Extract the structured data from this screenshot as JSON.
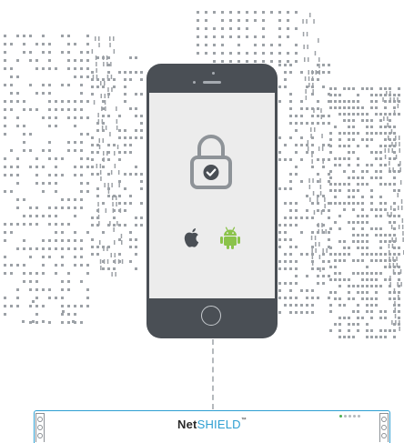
{
  "appliance": {
    "brand_prefix": "Net",
    "brand_main": "SHIELD",
    "brand_mark": "™",
    "leds": [
      true,
      false,
      false,
      false,
      false
    ]
  },
  "icons": {
    "lock": "lock-icon",
    "check": "check-circle-icon",
    "apple": "apple-logo-icon",
    "android": "android-logo-icon"
  },
  "colors": {
    "brand_blue": "#2e9fd2",
    "phone_body": "#4a4f55",
    "screen": "#ececec",
    "android_green": "#8bc34a",
    "city_gray": "#9ca1a6"
  }
}
